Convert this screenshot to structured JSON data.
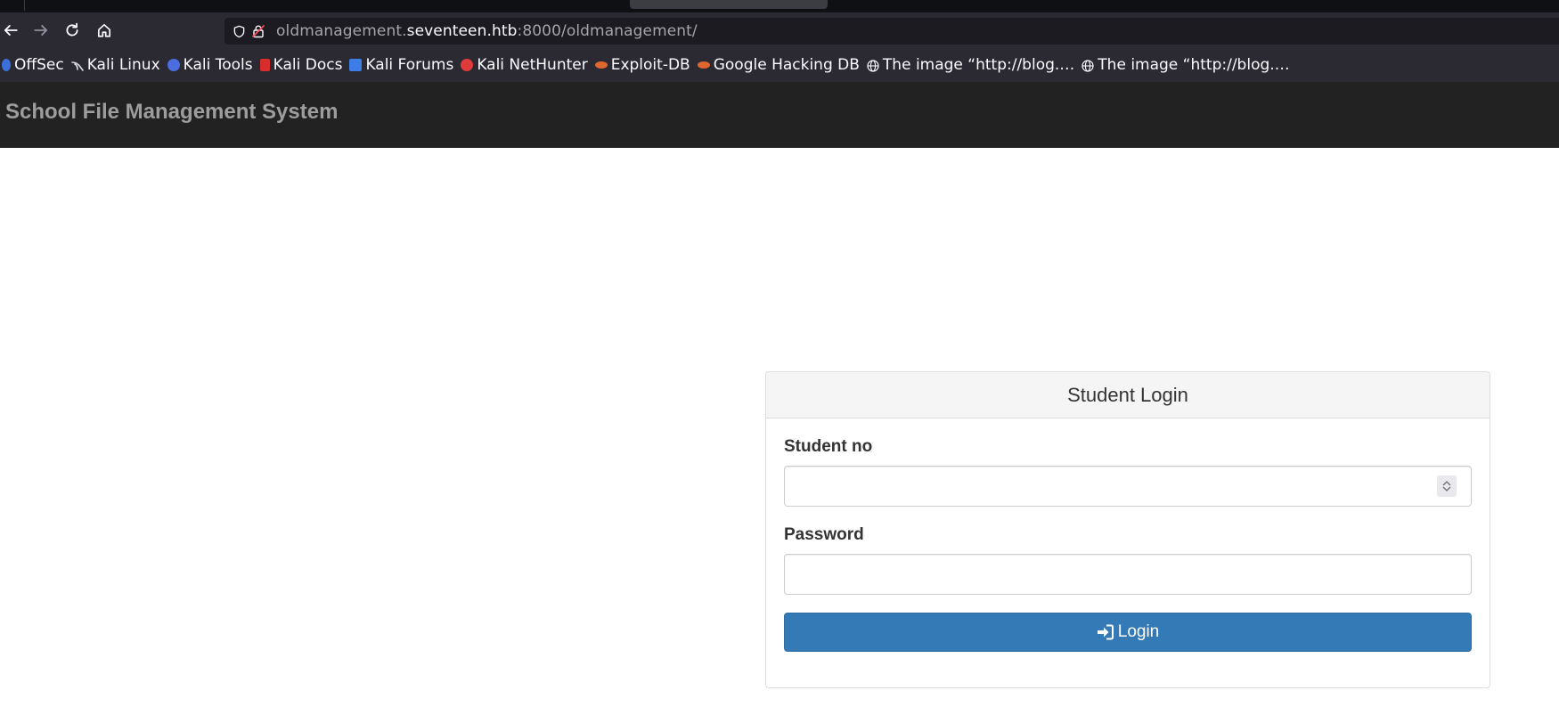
{
  "browser": {
    "url": {
      "prefix": "oldmanagement.",
      "domain": "seventeen.htb",
      "suffix": ":8000/oldmanagement/"
    },
    "bookmarks": [
      {
        "label": "OffSec",
        "icon": "offsec-icon",
        "color": "#3d6fd8"
      },
      {
        "label": "Kali Linux",
        "icon": "kali-linux-icon",
        "color": "#d9dde5"
      },
      {
        "label": "Kali Tools",
        "icon": "kali-tools-icon",
        "color": "#4a6ee0"
      },
      {
        "label": "Kali Docs",
        "icon": "kali-docs-icon",
        "color": "#d92d2d"
      },
      {
        "label": "Kali Forums",
        "icon": "kali-forums-icon",
        "color": "#3e7ce6"
      },
      {
        "label": "Kali NetHunter",
        "icon": "kali-nethunter-icon",
        "color": "#e03a3a"
      },
      {
        "label": "Exploit-DB",
        "icon": "exploit-db-icon",
        "color": "#e0662f"
      },
      {
        "label": "Google Hacking DB",
        "icon": "google-hacking-db-icon",
        "color": "#e0662f"
      },
      {
        "label": "The image “http://blog.…",
        "icon": "globe-icon",
        "color": "#fbfbfe"
      },
      {
        "label": "The image “http://blog.…",
        "icon": "globe-icon",
        "color": "#fbfbfe"
      }
    ]
  },
  "page": {
    "brand": "School File Management System",
    "panel": {
      "title": "Student Login",
      "student_no_label": "Student no",
      "student_no_value": "",
      "password_label": "Password",
      "password_value": "",
      "login_label": "Login"
    }
  },
  "colors": {
    "header_bg": "#222222",
    "brand_text": "#9d9d9d",
    "primary_button": "#337ab7"
  }
}
